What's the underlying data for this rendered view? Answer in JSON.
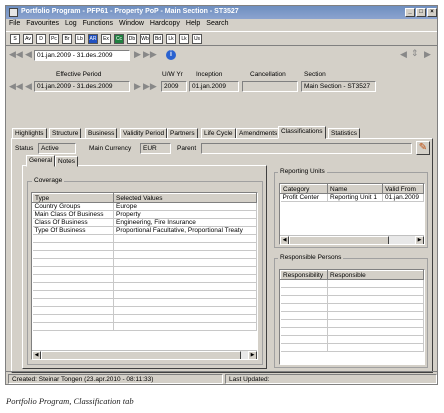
{
  "window": {
    "title": "Portfolio Program - PFP61 - Property PoP - Main Section - ST3527",
    "controls": {
      "minimize": "_",
      "maximize": "□",
      "close": "×"
    }
  },
  "menu": [
    "File",
    "Favourites",
    "Log",
    "Functions",
    "Window",
    "Hardcopy",
    "Help",
    "Search"
  ],
  "toolbar": {
    "buttons": [
      {
        "label": "S",
        "icon": "s-icon"
      },
      {
        "label": "Av",
        "icon": "av-icon"
      },
      {
        "label": "D",
        "icon": "d-icon"
      },
      {
        "label": "Pc",
        "icon": "pc-icon"
      },
      {
        "label": "Br",
        "icon": "br-icon"
      },
      {
        "label": "Lb",
        "icon": "lb-icon"
      },
      {
        "label": "AR",
        "icon": "ar-icon"
      },
      {
        "label": "Ex",
        "icon": "ex-icon"
      },
      {
        "label": "Cc",
        "icon": "cc-icon"
      },
      {
        "label": "Db",
        "icon": "db-icon"
      },
      {
        "label": "Wb",
        "icon": "web-icon"
      },
      {
        "label": "Bd",
        "icon": "building-icon"
      },
      {
        "label": "Lk",
        "icon": "link-icon"
      },
      {
        "label": "Lk",
        "icon": "link2-icon"
      },
      {
        "label": "Us",
        "icon": "users-icon"
      }
    ]
  },
  "nav": {
    "period_value": "01.jan.2009 - 31.des.2009",
    "info_icon": "i"
  },
  "header": {
    "effective_period_label": "Effective Period",
    "effective_period_value": "01.jan.2009 - 31.des.2009",
    "uw_yr_label": "U/W Yr",
    "uw_yr_value": "2009",
    "inception_label": "Inception",
    "inception_value": "01.jan.2009",
    "cancellation_label": "Cancellation",
    "cancellation_value": "",
    "section_label": "Section",
    "section_value": "Main Section - ST3527"
  },
  "tabs": [
    "Highlights",
    "Structure",
    "Business",
    "Validity Period",
    "Partners",
    "Life Cycle",
    "Amendments",
    "Classifications",
    "Statistics"
  ],
  "active_tab": "Classifications",
  "status_row": {
    "status_label": "Status",
    "status_value": "Active",
    "currency_label": "Main Currency",
    "currency_value": "EUR",
    "parent_label": "Parent",
    "parent_value": ""
  },
  "subtabs": [
    "General",
    "Notes"
  ],
  "coverage": {
    "group_label": "Coverage",
    "columns": [
      "Type",
      "Selected Values"
    ],
    "rows": [
      [
        "Country Groups",
        "Europe"
      ],
      [
        "Main Class Of Business",
        "Property"
      ],
      [
        "Class Of Business",
        "Engineering, Fire Insurance"
      ],
      [
        "Type Of Business",
        "Proportional Facultative, Proportional Treaty"
      ]
    ]
  },
  "reporting_units": {
    "group_label": "Reporting Units",
    "columns": [
      "Category",
      "Name",
      "Valid From"
    ],
    "rows": [
      [
        "Profit Center",
        "Reporting Unit 1",
        "01.jan.2009"
      ]
    ]
  },
  "responsible_persons": {
    "group_label": "Responsible Persons",
    "columns": [
      "Responsibility",
      "Responsible"
    ],
    "rows": []
  },
  "statusbar": {
    "created": "Created: Steinar Tongen (23.apr.2010 - 08:11:33)",
    "last_updated": "Last Updated:"
  },
  "caption": "Portfolio Program, Classification tab"
}
